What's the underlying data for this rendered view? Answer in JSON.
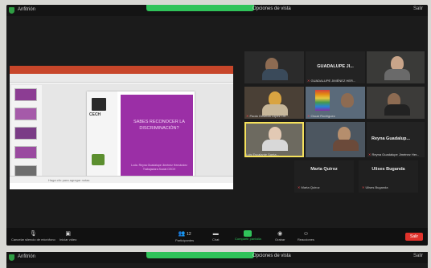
{
  "window": {
    "host_label": "Anfitrión",
    "view_label": "Opciones de vista",
    "exit_label": "Salir"
  },
  "presentation": {
    "slide_title": "SABES RECONOCER LA DISCRIMINACIÓN?",
    "slide_subtitle": "Lcda. Reyna Guadalupe Jiménez Hernández Trabajadora Social CECH",
    "logo_text": "CECH",
    "notes_label": "Haga clic para agregar notas"
  },
  "participants": [
    {
      "name": "",
      "style": "person"
    },
    {
      "name": "GUADALUPE JI...",
      "sub": "GUADALUPE JIMÉNEZ HER...",
      "style": "name"
    },
    {
      "name": "",
      "sub": "",
      "style": "person"
    },
    {
      "name": "",
      "sub": "Paola Griselda López Ort...",
      "style": "person"
    },
    {
      "name": "",
      "sub": "Oscar Rodríguez",
      "style": "rainbow"
    },
    {
      "name": "",
      "sub": "",
      "style": "person"
    },
    {
      "name": "",
      "sub": "Luis Escalante Santa...",
      "style": "person",
      "active": true
    },
    {
      "name": "",
      "sub": "",
      "style": "person"
    },
    {
      "name": "Reyna Guadalup...",
      "sub": "Reyna Guadalupe Jiménez Her...",
      "style": "name"
    }
  ],
  "muted": [
    {
      "display": "Marta Quiroz",
      "label": "Marta Quiroz"
    },
    {
      "display": "Ulises Buganda",
      "label": "Ulises Buganda"
    }
  ],
  "toolbar": {
    "unmute": "Cancelar silencio de micrófono",
    "video": "Iniciar video",
    "participants": "Participantes",
    "participants_count": "12",
    "chat": "Chat",
    "share": "Compartir pantalla",
    "record": "Grabar",
    "reactions": "Reacciones",
    "end": "Salir"
  }
}
